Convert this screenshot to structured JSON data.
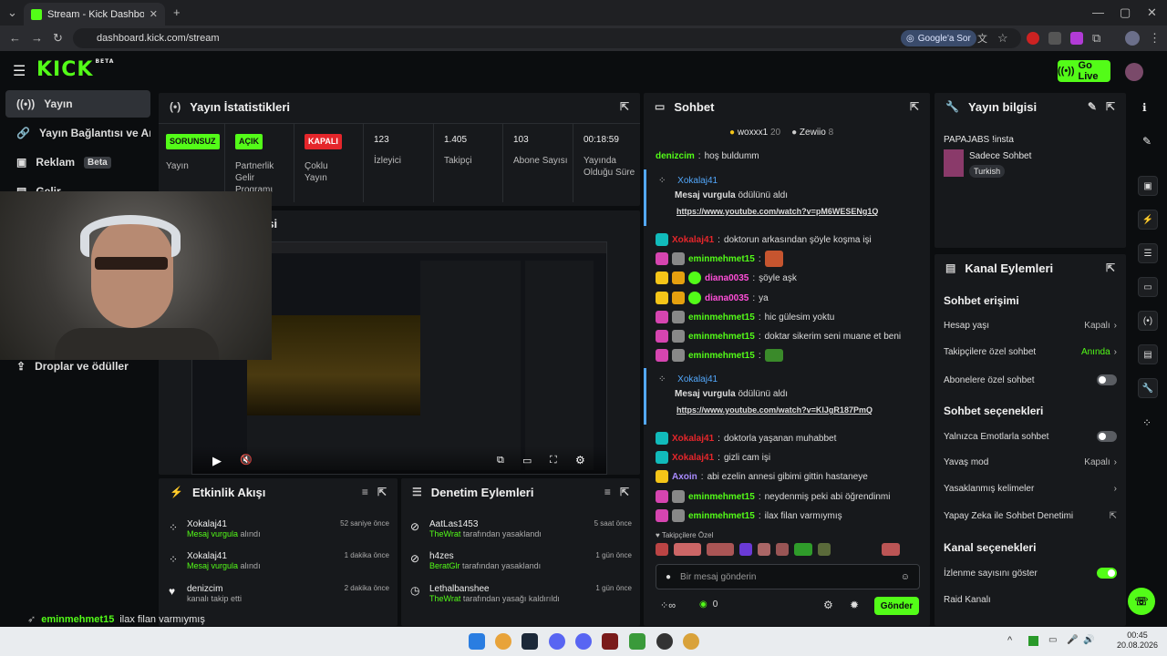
{
  "browser": {
    "tab_title": "Stream - Kick Dashboard",
    "url": "dashboard.kick.com/stream",
    "google_btn": "Google'a Sor"
  },
  "topbar": {
    "logo": "KICK",
    "logo_tag": "BETA",
    "go_live": "Go Live",
    "brand_color": "#53fc18"
  },
  "sidebar": {
    "items": [
      {
        "label": "Yayın",
        "icon": "broadcast-icon"
      },
      {
        "label": "Yayın Bağlantısı ve Anahtarı",
        "icon": "link-icon"
      },
      {
        "label": "Reklam",
        "badge": "Beta",
        "icon": "ad-icon"
      },
      {
        "label": "Gelir",
        "icon": "money-icon"
      },
      {
        "label": "Droplar ve ödüller",
        "icon": "gift-icon"
      }
    ]
  },
  "stats": {
    "title": "Yayın İstatistikleri",
    "cards": [
      {
        "pill": "SORUNSUZ",
        "pill_color": "#53fc18",
        "label": "Yayın"
      },
      {
        "pill": "AÇIK",
        "pill_color": "#53fc18",
        "label": "Partnerlik Gelir Programı"
      },
      {
        "pill": "KAPALI",
        "pill_color": "#e5262b",
        "label": "Çoklu Yayın"
      },
      {
        "value": "123",
        "label": "İzleyici"
      },
      {
        "value": "1.405",
        "label": "Takipçi"
      },
      {
        "value": "103",
        "label": "Abone Sayısı"
      },
      {
        "value": "00:18:59",
        "label": "Yayında Olduğu Süre"
      }
    ]
  },
  "preview": {
    "title_fragment": "esi"
  },
  "activity": {
    "title": "Etkinlik Akışı",
    "items": [
      {
        "user": "Xokalaj41",
        "action_strong": "Mesaj vurgula",
        "action": "alındı",
        "time": "52 saniye önce"
      },
      {
        "user": "Xokalaj41",
        "action_strong": "Mesaj vurgula",
        "action": "alındı",
        "time": "1 dakika önce"
      },
      {
        "user": "denizcim",
        "action_strong": "",
        "action": "kanalı takip etti",
        "time": "2 dakika önce"
      }
    ]
  },
  "moderation": {
    "title": "Denetim Eylemleri",
    "items": [
      {
        "user": "AatLas1453",
        "by": "TheWrat",
        "action": "tarafından yasaklandı",
        "time": "5 saat önce"
      },
      {
        "user": "h4zes",
        "by": "BeratGlr",
        "action": "tarafından yasaklandı",
        "time": "1 gün önce"
      },
      {
        "user": "Lethalbanshee",
        "by": "TheWrat",
        "action": "tarafından yasağı kaldırıldı",
        "time": "1 gün önce"
      }
    ]
  },
  "chat": {
    "title": "Sohbet",
    "top_gifters": [
      {
        "name": "woxxx1",
        "count": "20"
      },
      {
        "name": "Zewiio",
        "count": "8"
      }
    ],
    "messages": [
      {
        "user": "denizcim",
        "text": "hoş buldumm",
        "color": "#53fc18"
      },
      {
        "user": "Xokalaj41",
        "text": "doktorun arkasından şöyle koşma işi",
        "color": "#e5262b"
      },
      {
        "user": "eminmehmet15",
        "text": "",
        "color": "#53fc18"
      },
      {
        "user": "diana0035",
        "text": "şöyle aşk",
        "color": "#ff4fd8"
      },
      {
        "user": "diana0035",
        "text": "ya",
        "color": "#ff4fd8"
      },
      {
        "user": "eminmehmet15",
        "text": "hic gülesim yoktu",
        "color": "#53fc18"
      },
      {
        "user": "eminmehmet15",
        "text": "doktar sikerim seni muane et beni",
        "color": "#53fc18"
      },
      {
        "user": "eminmehmet15",
        "text": "",
        "color": "#53fc18"
      },
      {
        "user": "Xokalaj41",
        "text": "doktorla yaşanan muhabbet",
        "color": "#e5262b"
      },
      {
        "user": "Xokalaj41",
        "text": "gizli cam işi",
        "color": "#e5262b"
      },
      {
        "user": "Axoin",
        "text": "abi ezelin annesi gibimi gittin hastaneye",
        "color": "#a98bff"
      },
      {
        "user": "eminmehmet15",
        "text": "neydenmiş peki abi öğrendinmi",
        "color": "#53fc18"
      },
      {
        "user": "eminmehmet15",
        "text": "ilax filan varmıymış",
        "color": "#53fc18"
      }
    ],
    "highlights": [
      {
        "user": "Xokalaj41",
        "reward": "Mesaj vurgula",
        "reward_suffix": "ödülünü aldı",
        "link": "https://www.youtube.com/watch?v=pM6WESENg1Q"
      },
      {
        "user": "Xokalaj41",
        "reward": "Mesaj vurgula",
        "reward_suffix": "ödülünü aldı",
        "link": "https://www.youtube.com/watch?v=KlJgR187PmQ"
      }
    ],
    "follower_only_label": "Takipçilere Özel",
    "input_placeholder": "Bir mesaj gönderin",
    "points": "0",
    "send_button": "Gönder"
  },
  "stream_info": {
    "title": "Yayın bilgisi",
    "stream_title": "PAPAJABS !insta",
    "category": "Sadece Sohbet",
    "tag": "Turkish"
  },
  "channel_actions": {
    "title": "Kanal Eylemleri",
    "chat_access_title": "Sohbet erişimi",
    "account_age": {
      "label": "Hesap yaşı",
      "value": "Kapalı"
    },
    "followers_only": {
      "label": "Takipçilere özel sohbet",
      "value": "Anında"
    },
    "subscribers_only": {
      "label": "Abonelere özel sohbet",
      "on": false
    },
    "chat_options_title": "Sohbet seçenekleri",
    "emote_only": {
      "label": "Yalnızca Emotlarla sohbet",
      "on": false
    },
    "slow_mode": {
      "label": "Yavaş mod",
      "value": "Kapalı"
    },
    "banned_words": {
      "label": "Yasaklanmış kelimeler"
    },
    "ai_moderation": {
      "label": "Yapay Zeka ile Sohbet Denetimi"
    },
    "channel_options_title": "Kanal seçenekleri",
    "show_viewers": {
      "label": "İzlenme sayısını göster",
      "on": true
    },
    "raid": {
      "label": "Raid Kanalı"
    }
  },
  "overlay_chat": {
    "user": "eminmehmet15",
    "text": "ilax filan varmıymış"
  },
  "taskbar": {
    "time": "00:45",
    "date": "20.08.2026"
  }
}
